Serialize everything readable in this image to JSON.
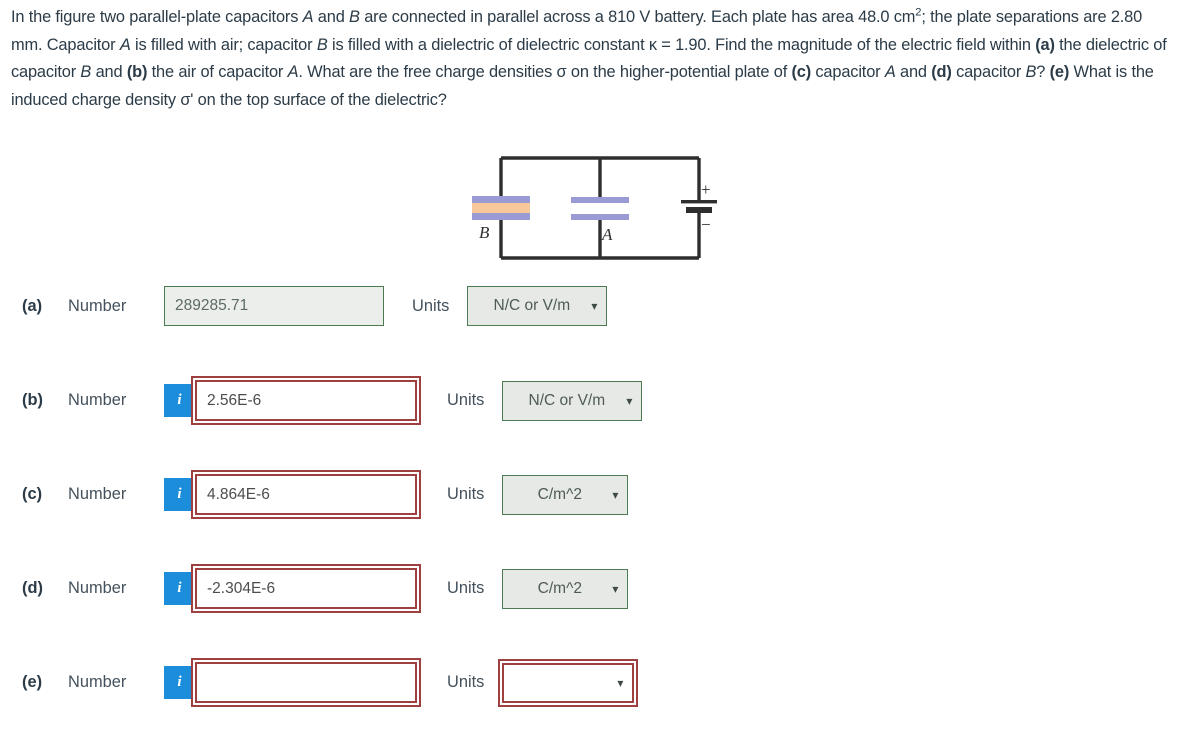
{
  "problem": {
    "segments": [
      {
        "t": "In the figure two parallel-plate capacitors ",
        "s": "plain"
      },
      {
        "t": "A",
        "s": "italic"
      },
      {
        "t": " and ",
        "s": "plain"
      },
      {
        "t": "B",
        "s": "italic"
      },
      {
        "t": " are connected in parallel across a 810 V battery. Each plate has area 48.0 cm",
        "s": "plain"
      },
      {
        "t": "2",
        "s": "sup"
      },
      {
        "t": "; the plate separations are 2.80 mm. Capacitor ",
        "s": "plain"
      },
      {
        "t": "A",
        "s": "italic"
      },
      {
        "t": " is filled with air; capacitor ",
        "s": "plain"
      },
      {
        "t": "B",
        "s": "italic"
      },
      {
        "t": " is filled with a dielectric of dielectric constant κ = 1.90. Find the magnitude of the electric field within ",
        "s": "plain"
      },
      {
        "t": "(a)",
        "s": "bold"
      },
      {
        "t": " the dielectric of capacitor ",
        "s": "plain"
      },
      {
        "t": "B",
        "s": "italic"
      },
      {
        "t": " and ",
        "s": "plain"
      },
      {
        "t": "(b)",
        "s": "bold"
      },
      {
        "t": " the air of capacitor ",
        "s": "plain"
      },
      {
        "t": "A",
        "s": "italic"
      },
      {
        "t": ". What are the free charge densities σ on the higher-potential plate of ",
        "s": "plain"
      },
      {
        "t": "(c)",
        "s": "bold"
      },
      {
        "t": " capacitor ",
        "s": "plain"
      },
      {
        "t": "A",
        "s": "italic"
      },
      {
        "t": " and ",
        "s": "plain"
      },
      {
        "t": "(d)",
        "s": "bold"
      },
      {
        "t": " capacitor ",
        "s": "plain"
      },
      {
        "t": "B",
        "s": "italic"
      },
      {
        "t": "? ",
        "s": "plain"
      },
      {
        "t": "(e)",
        "s": "bold"
      },
      {
        "t": " What is the induced charge density σ' on the top surface of the dielectric?",
        "s": "plain"
      }
    ]
  },
  "figure": {
    "label_capacitor_b": "B",
    "label_capacitor_a": "A",
    "battery_positive": "+",
    "battery_negative": "−",
    "colors": {
      "wire": "#2e2e2e",
      "plate": "#9a9ad4",
      "dielectric": "#f8c89a",
      "battery": "#2e2e2e"
    }
  },
  "labels": {
    "number": "Number",
    "units": "Units",
    "info_icon": "i",
    "caret": "⌄"
  },
  "rows": [
    {
      "part": "(a)",
      "number_label": "Number",
      "value": "289285.71",
      "units_label": "Units",
      "unit_value": "N/C or V/m",
      "state": "correct",
      "has_info": false
    },
    {
      "part": "(b)",
      "number_label": "Number",
      "value": "2.56E-6",
      "units_label": "Units",
      "unit_value": "N/C or V/m",
      "state": "wrong",
      "unit_state": "correct",
      "has_info": true
    },
    {
      "part": "(c)",
      "number_label": "Number",
      "value": "4.864E-6",
      "units_label": "Units",
      "unit_value": "C/m^2",
      "state": "wrong",
      "unit_state": "correct",
      "has_info": true
    },
    {
      "part": "(d)",
      "number_label": "Number",
      "value": "-2.304E-6",
      "units_label": "Units",
      "unit_value": "C/m^2",
      "state": "wrong",
      "unit_state": "correct",
      "has_info": true
    },
    {
      "part": "(e)",
      "number_label": "Number",
      "value": "",
      "units_label": "Units",
      "unit_value": "",
      "state": "wrong",
      "unit_state": "wrong",
      "has_info": true
    }
  ],
  "colors": {
    "info_blue": "#1b8ddb",
    "error_red": "#9e4040",
    "correct_green": "#4c7a52",
    "text": "#2b3b47"
  }
}
